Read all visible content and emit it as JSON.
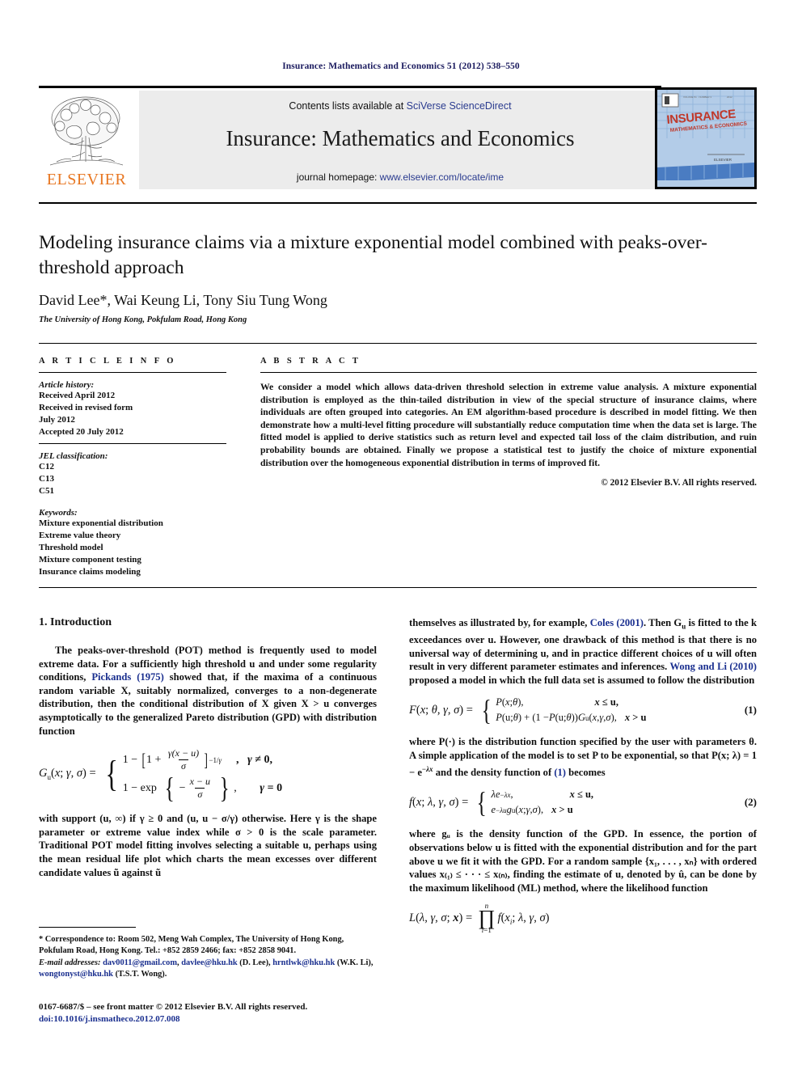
{
  "running_head": "Insurance: Mathematics and Economics 51 (2012) 538–550",
  "masthead": {
    "contents_prefix": "Contents lists available at ",
    "sciverse_link": "SciVerse ScienceDirect",
    "journal_title": "Insurance: Mathematics and Economics",
    "homepage_prefix": "journal homepage: ",
    "homepage_link": "www.elsevier.com/locate/ime",
    "publisher": "ELSEVIER",
    "cover_title": "INSURANCE",
    "cover_subtitle": "MATHEMATICS & ECONOMICS",
    "link_color": "#2a3b8f",
    "publisher_color": "#e87722"
  },
  "article": {
    "title": "Modeling insurance claims via a mixture exponential model combined with peaks-over-threshold approach",
    "authors": "David Lee*, Wai Keung Li, Tony Siu Tung Wong",
    "affiliation": "The University of Hong Kong, Pokfulam Road, Hong Kong"
  },
  "info": {
    "heading": "A R T I C L E   I N F O",
    "history_label": "Article history:",
    "history": [
      "Received April 2012",
      "Received in revised form",
      "July 2012",
      "Accepted 20 July 2012"
    ],
    "jel_label": "JEL classification:",
    "jel": [
      "C12",
      "C13",
      "C51"
    ],
    "keywords_label": "Keywords:",
    "keywords": [
      "Mixture exponential distribution",
      "Extreme value theory",
      "Threshold model",
      "Mixture component testing",
      "Insurance claims modeling"
    ]
  },
  "abstract": {
    "heading": "A B S T R A C T",
    "text": "We consider a model which allows data-driven threshold selection in extreme value analysis. A mixture exponential distribution is employed as the thin-tailed distribution in view of the special structure of insurance claims, where individuals are often grouped into categories. An EM algorithm-based procedure is described in model fitting. We then demonstrate how a multi-level fitting procedure will substantially reduce computation time when the data set is large. The fitted model is applied to derive statistics such as return level and expected tail loss of the claim distribution, and ruin probability bounds are obtained. Finally we propose a statistical test to justify the choice of mixture exponential distribution over the homogeneous exponential distribution in terms of improved fit.",
    "copyright": "© 2012 Elsevier B.V. All rights reserved."
  },
  "body": {
    "section_heading": "1. Introduction",
    "left_p1_a": "The peaks-over-threshold (POT) method is frequently used to model extreme data. For a sufficiently high threshold u and under some regularity conditions, ",
    "left_p1_cite": "Pickands (1975)",
    "left_p1_b": " showed that, if the maxima of a continuous random variable X, suitably normalized, converges to a non-degenerate distribution, then the conditional distribution of X given X > u converges asymptotically to the generalized Pareto distribution (GPD) with distribution function",
    "left_p2": "with support (u, ∞) if γ ≥ 0 and (u, u − σ/γ) otherwise. Here γ is the shape parameter or extreme value index while σ > 0 is the scale parameter. Traditional POT model fitting involves selecting a suitable u, perhaps using the mean residual life plot which charts the mean excesses over different candidate values ũ against ũ",
    "right_p1_a": "themselves as illustrated by, for example, ",
    "right_p1_cite1": "Coles (2001)",
    "right_p1_b": ". Then G",
    "right_p1_c": " is fitted to the k exceedances over u. However, one drawback of this method is that there is no universal way of determining u, and in practice different choices of u will often result in very different parameter estimates and inferences. ",
    "right_p1_cite2": "Wong and Li (2010)",
    "right_p1_d": " proposed a model in which the full data set is assumed to follow the distribution",
    "right_p2_a": "where P(·) is the distribution function specified by the user with parameters θ. A simple application of the model is to set P to be exponential, so that P(x; λ) = 1 − e",
    "right_p2_b": " and the density function of ",
    "right_p2_cite": "(1)",
    "right_p2_c": " becomes",
    "right_p3": "where gᵤ is the density function of the GPD. In essence, the portion of observations below u is fitted with the exponential distribution and for the part above u we fit it with the GPD. For a random sample {x₁, . . . , xₙ} with ordered values x₍₁₎ ≤ · · · ≤ x₍ₙ₎, finding the estimate of u, denoted by û, can be done by the maximum likelihood (ML) method, where the likelihood function"
  },
  "equations": {
    "eq_gpd_number": "",
    "eq1_number": "(1)",
    "eq2_number": "(2)"
  },
  "footnotes": {
    "correspondence": "* Correspondence to: Room 502, Meng Wah Complex, The University of Hong Kong, Pokfulam Road, Hong Kong. Tel.: +852 2859 2466; fax: +852 2858 9041.",
    "email_label": "E-mail addresses:",
    "emails": [
      {
        "address": "dav0011@gmail.com",
        "owner": ""
      },
      {
        "address": "davlee@hku.hk",
        "owner": " (D. Lee),"
      },
      {
        "address": "hrntlwk@hku.hk",
        "owner": " (W.K. Li),"
      },
      {
        "address": "wongtonyst@hku.hk",
        "owner": " (T.S.T. Wong)."
      }
    ],
    "issn_line": "0167-6687/$ – see front matter © 2012 Elsevier B.V. All rights reserved.",
    "doi": "doi:10.1016/j.insmatheco.2012.07.008"
  }
}
